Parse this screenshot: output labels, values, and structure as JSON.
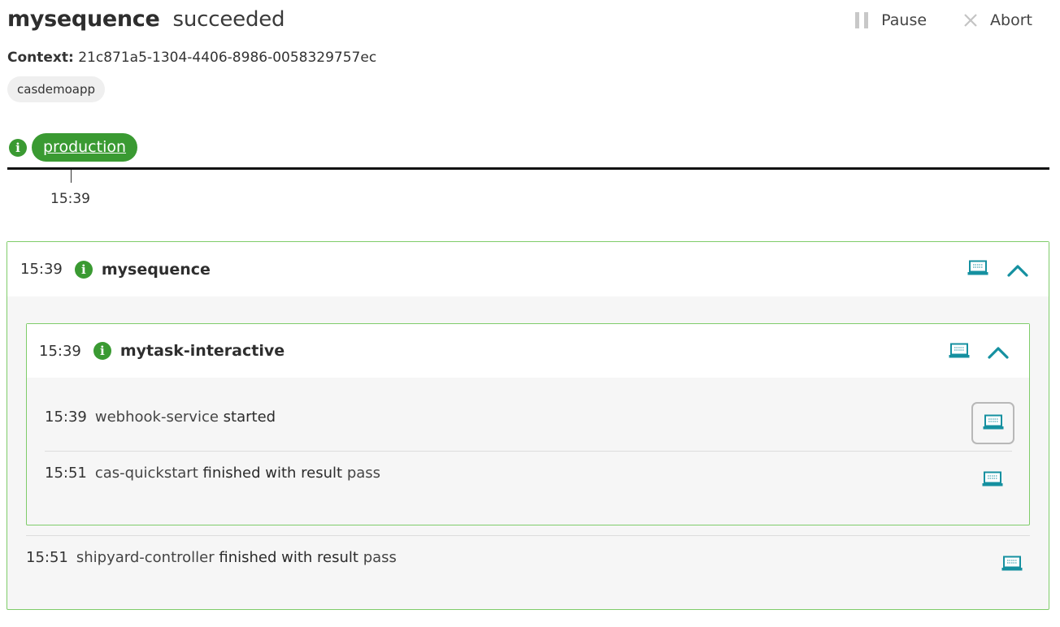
{
  "sequence": {
    "name": "mysequence",
    "status": "succeeded",
    "context_label": "Context:",
    "context_id": "21c871a5-1304-4406-8986-0058329757ec",
    "project_tag": "casdemoapp"
  },
  "actions": {
    "pause_label": "Pause",
    "abort_label": "Abort"
  },
  "stage": {
    "name": "production",
    "info_icon": "i",
    "timeline_tick": "15:39"
  },
  "colors": {
    "success_green": "#3a9a32",
    "card_border": "#7fcc6a",
    "teal_icon": "#1590a0"
  },
  "outer_card": {
    "time": "15:39",
    "title": "mysequence",
    "info_icon": "i"
  },
  "inner_card": {
    "time": "15:39",
    "title": "mytask-interactive",
    "info_icon": "i",
    "events": [
      {
        "time": "15:39",
        "source": "webhook-service",
        "verb": "started",
        "result": ""
      },
      {
        "time": "15:51",
        "source": "cas-quickstart",
        "verb": "finished with result",
        "result": "pass"
      }
    ]
  },
  "outer_events": [
    {
      "time": "15:51",
      "source": "shipyard-controller",
      "verb": "finished with result",
      "result": "pass"
    }
  ],
  "icons": {
    "payload": "laptop-icon",
    "collapse": "chevron-up-icon",
    "pause": "pause-icon",
    "abort": "close-icon",
    "info": "info-icon"
  }
}
